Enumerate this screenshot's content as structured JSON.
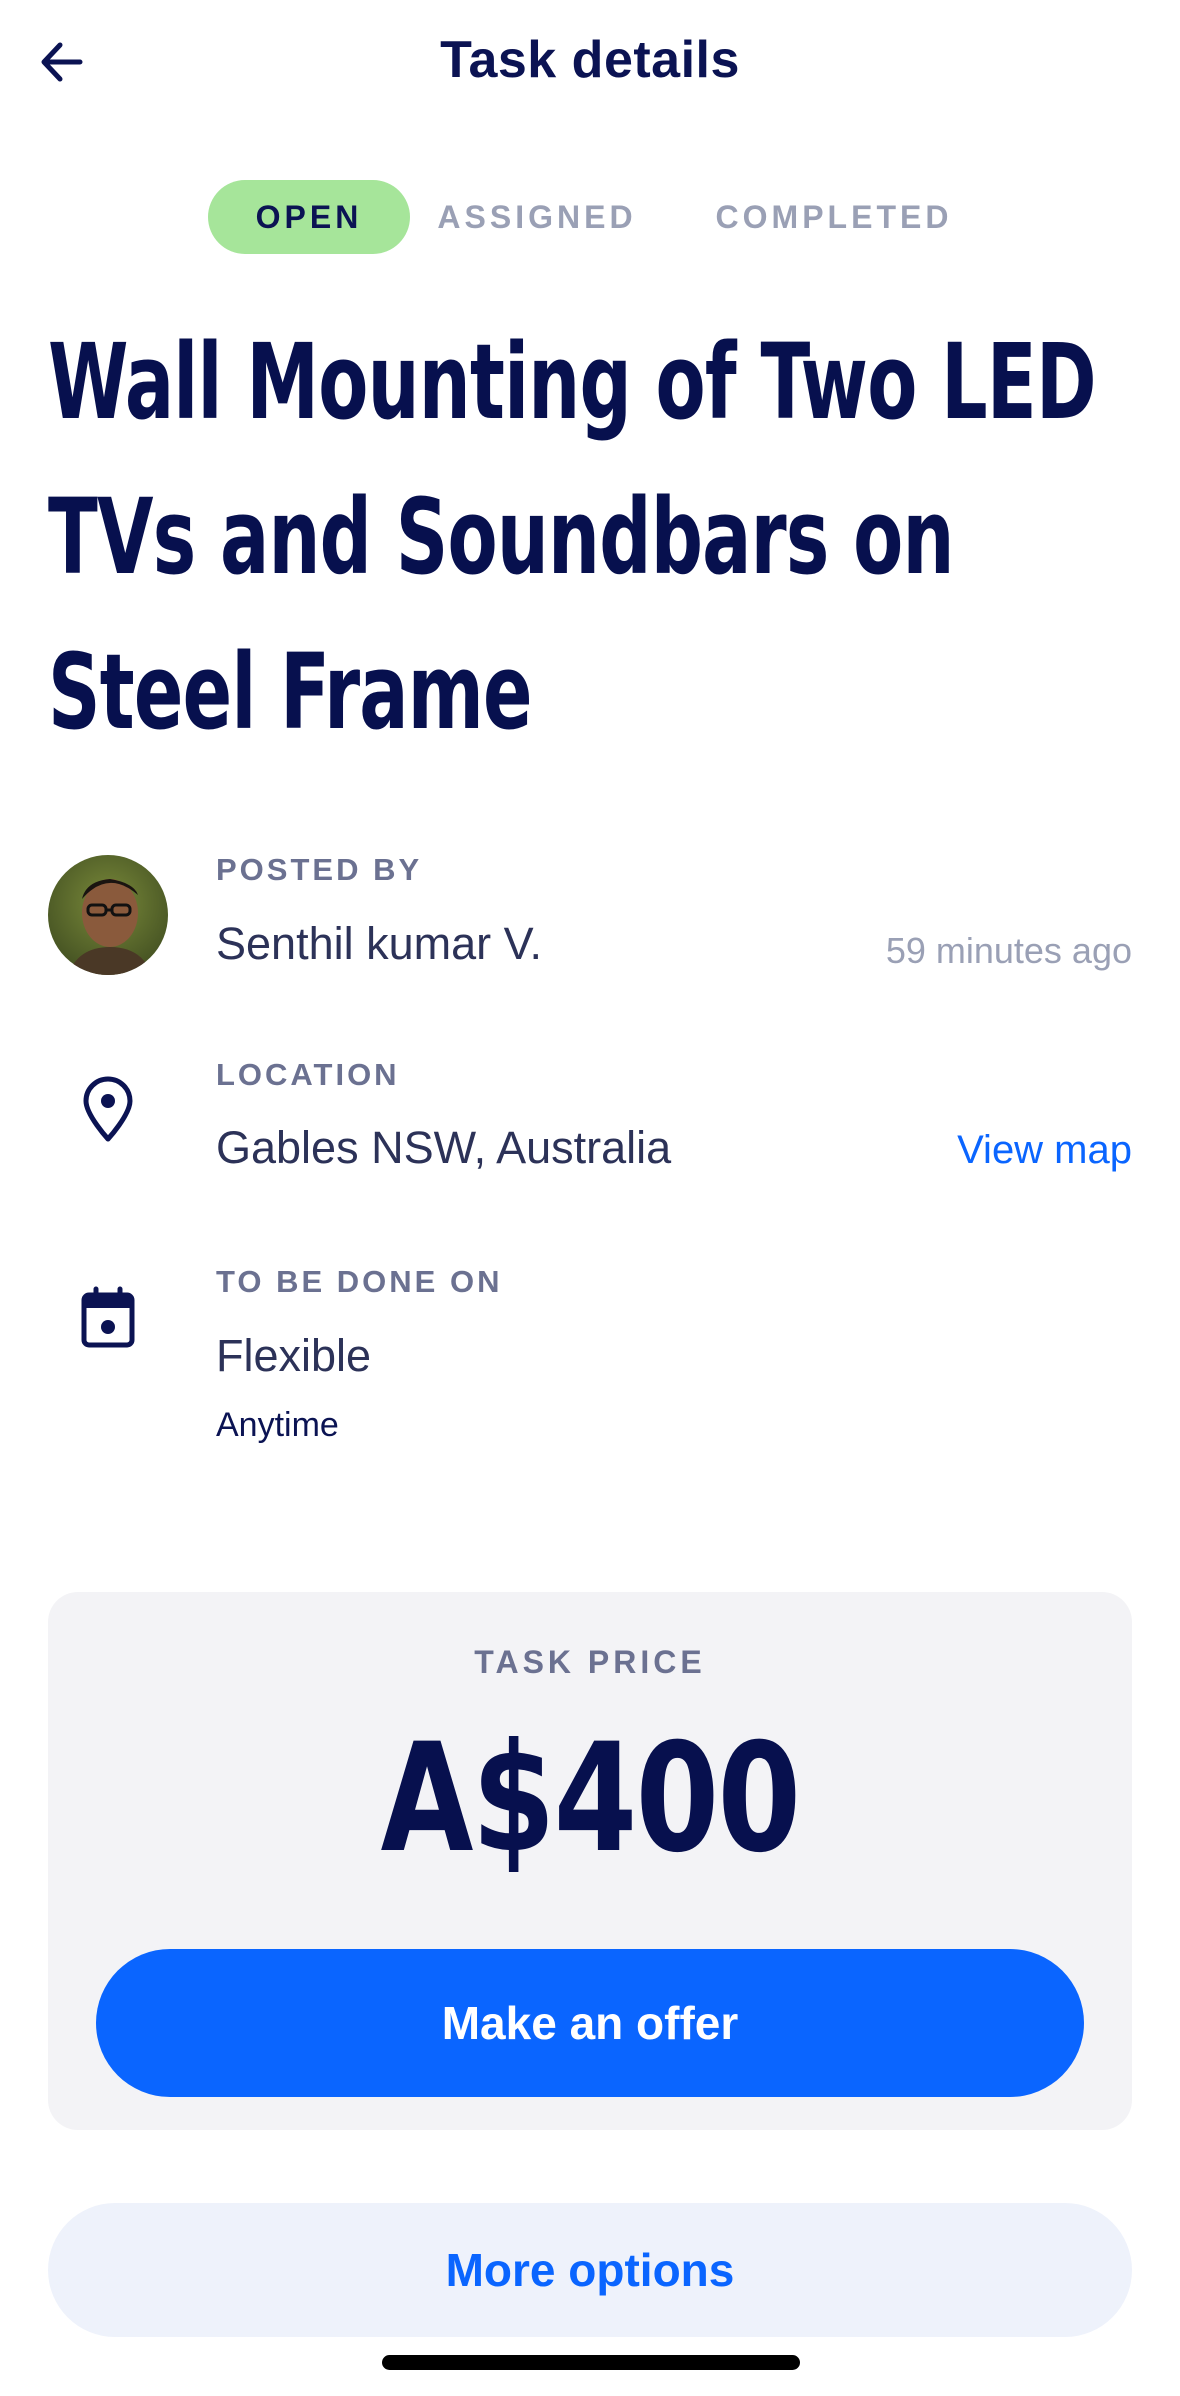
{
  "header": {
    "title": "Task details",
    "back_icon": "arrow-left-icon"
  },
  "status_tabs": [
    {
      "label": "OPEN",
      "active": true,
      "color": "#a6e59a"
    },
    {
      "label": "ASSIGNED",
      "active": false
    },
    {
      "label": "COMPLETED",
      "active": false
    }
  ],
  "task": {
    "title": "Wall Mounting of Two LED TVs and Soundbars on Steel Frame"
  },
  "posted_by": {
    "label": "POSTED BY",
    "name": "Senthil kumar V.",
    "time": "59 minutes ago"
  },
  "location": {
    "label": "LOCATION",
    "value": "Gables NSW, Australia",
    "link": "View map",
    "icon": "location-pin-icon"
  },
  "schedule": {
    "label": "TO BE DONE ON",
    "value": "Flexible",
    "sub": "Anytime",
    "icon": "calendar-icon"
  },
  "price": {
    "label": "TASK PRICE",
    "value": "A$400",
    "button": "Make an offer"
  },
  "more_options": "More options",
  "colors": {
    "primary": "#0a65ff",
    "navy": "#0b1353",
    "open_badge": "#a6e59a"
  }
}
